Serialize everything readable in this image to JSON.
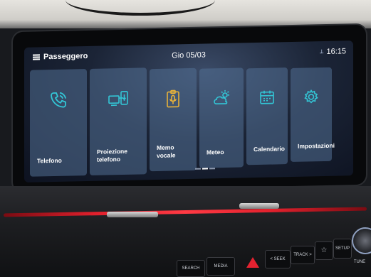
{
  "header": {
    "menu_label": "Passeggero",
    "date": "Gio 05/03",
    "time": "16:15"
  },
  "tiles": [
    {
      "label": "Telefono",
      "icon": "phone-icon"
    },
    {
      "label": "Proiezione\ntelefono",
      "icon": "phone-projection-icon"
    },
    {
      "label": "Memo vocale",
      "icon": "voice-memo-icon"
    },
    {
      "label": "Meteo",
      "icon": "weather-icon"
    },
    {
      "label": "Calendario",
      "icon": "calendar-icon"
    },
    {
      "label": "Impostazioni",
      "icon": "gear-icon"
    }
  ],
  "hardkeys": {
    "search": "SEARCH",
    "media": "MEDIA",
    "seek": "< SEEK",
    "track": "TRACK >",
    "setup": "SETUP",
    "tune": "TUNE"
  },
  "colors": {
    "accent": "#33c6d6",
    "tile": "#52708f",
    "red_trim": "#e0202c"
  }
}
